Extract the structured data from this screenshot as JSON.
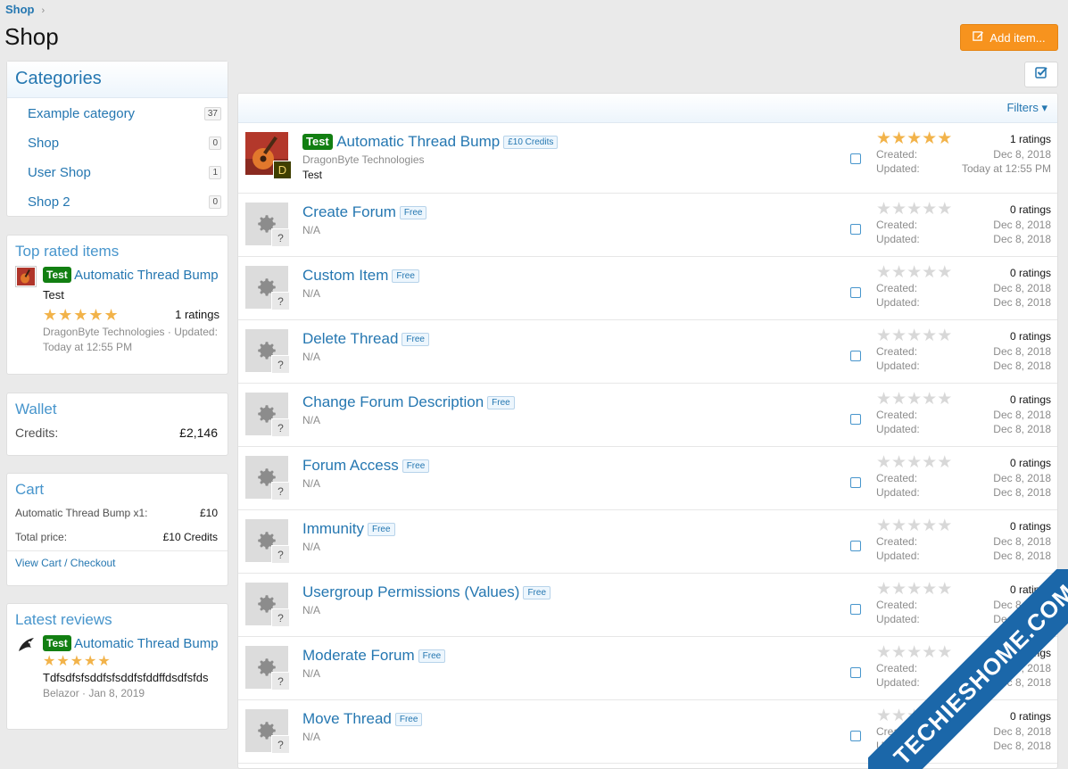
{
  "breadcrumb": {
    "label": "Shop",
    "sep": "›"
  },
  "page": {
    "title": "Shop"
  },
  "toolbar": {
    "add_label": "Add item..."
  },
  "filters": {
    "label": "Filters"
  },
  "categories": {
    "title": "Categories",
    "items": [
      {
        "label": "Example category",
        "count": "37"
      },
      {
        "label": "Shop",
        "count": "0"
      },
      {
        "label": "User Shop",
        "count": "1"
      },
      {
        "label": "Shop 2",
        "count": "0"
      }
    ]
  },
  "top_rated": {
    "title": "Top rated items",
    "tag": "Test",
    "item_title": "Automatic Thread Bump",
    "desc": "Test",
    "stars": "★★★★★",
    "ratings": "1 ratings",
    "meta": "DragonByte Technologies · Updated: Today at 12:55 PM"
  },
  "wallet": {
    "title": "Wallet",
    "credits_label": "Credits:",
    "credits_value": "£2,146"
  },
  "cart": {
    "title": "Cart",
    "line_label": "Automatic Thread Bump x1:",
    "line_value": "£10",
    "total_label": "Total price:",
    "total_value": "£10 Credits",
    "checkout_link": "View Cart / Checkout"
  },
  "reviews": {
    "title": "Latest reviews",
    "tag": "Test",
    "item_title": "Automatic Thread Bump",
    "stars": "★★★★★",
    "text": "Tdfsdfsfsddfsfsddfsfddffdsdfsfds",
    "meta": "Belazor · Jan 8, 2019"
  },
  "items": [
    {
      "tag": "Test",
      "title": "Automatic Thread Bump",
      "price": "£10 Credits",
      "sub": "DragonByte Technologies",
      "desc": "Test",
      "rating": 5,
      "ratings": "1 ratings",
      "created_label": "Created:",
      "created": "Dec 8, 2018",
      "updated_label": "Updated:",
      "updated": "Today at 12:55 PM",
      "avatar_letter": "D"
    },
    {
      "title": "Create Forum",
      "price": "Free",
      "sub": "N/A",
      "rating": 0,
      "ratings": "0 ratings",
      "created_label": "Created:",
      "created": "Dec 8, 2018",
      "updated_label": "Updated:",
      "updated": "Dec 8, 2018"
    },
    {
      "title": "Custom Item",
      "price": "Free",
      "sub": "N/A",
      "rating": 0,
      "ratings": "0 ratings",
      "created_label": "Created:",
      "created": "Dec 8, 2018",
      "updated_label": "Updated:",
      "updated": "Dec 8, 2018"
    },
    {
      "title": "Delete Thread",
      "price": "Free",
      "sub": "N/A",
      "rating": 0,
      "ratings": "0 ratings",
      "created_label": "Created:",
      "created": "Dec 8, 2018",
      "updated_label": "Updated:",
      "updated": "Dec 8, 2018"
    },
    {
      "title": "Change Forum Description",
      "price": "Free",
      "sub": "N/A",
      "rating": 0,
      "ratings": "0 ratings",
      "created_label": "Created:",
      "created": "Dec 8, 2018",
      "updated_label": "Updated:",
      "updated": "Dec 8, 2018"
    },
    {
      "title": "Forum Access",
      "price": "Free",
      "sub": "N/A",
      "rating": 0,
      "ratings": "0 ratings",
      "created_label": "Created:",
      "created": "Dec 8, 2018",
      "updated_label": "Updated:",
      "updated": "Dec 8, 2018"
    },
    {
      "title": "Immunity",
      "price": "Free",
      "sub": "N/A",
      "rating": 0,
      "ratings": "0 ratings",
      "created_label": "Created:",
      "created": "Dec 8, 2018",
      "updated_label": "Updated:",
      "updated": "Dec 8, 2018"
    },
    {
      "title": "Usergroup Permissions (Values)",
      "price": "Free",
      "sub": "N/A",
      "rating": 0,
      "ratings": "0 ratings",
      "created_label": "Created:",
      "created": "Dec 8, 2018",
      "updated_label": "Updated:",
      "updated": "Dec 8, 2018"
    },
    {
      "title": "Moderate Forum",
      "price": "Free",
      "sub": "N/A",
      "rating": 0,
      "ratings": "0 ratings",
      "created_label": "Created:",
      "created": "Dec 8, 2018",
      "updated_label": "Updated:",
      "updated": "Dec 8, 2018"
    },
    {
      "title": "Move Thread",
      "price": "Free",
      "sub": "N/A",
      "rating": 0,
      "ratings": "0 ratings",
      "created_label": "Created:",
      "created": "Dec 8, 2018",
      "updated_label": "Updated:",
      "updated": "Dec 8, 2018"
    }
  ],
  "watermark": {
    "text": "TECHIESHOME.COM"
  },
  "colors": {
    "accent": "#2577b1",
    "button": "#f7931e",
    "star": "#f2b34a",
    "tag": "#127f12"
  }
}
